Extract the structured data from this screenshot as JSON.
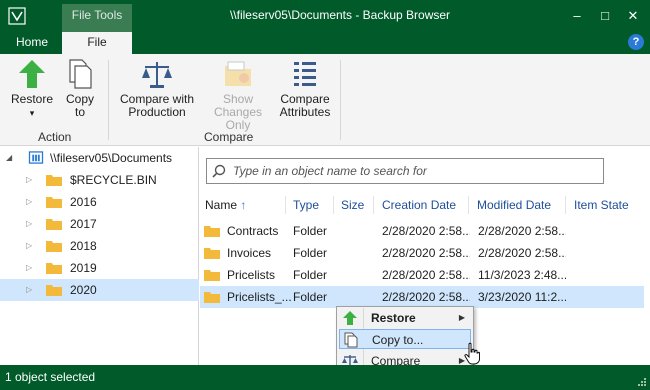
{
  "window": {
    "title": "\\\\fileserv05\\Documents - Backup Browser",
    "context_tab": "File Tools",
    "minimize": "–",
    "maximize": "□",
    "close": "✕"
  },
  "ribbon_tabs": {
    "home": "Home",
    "file": "File",
    "help": "?"
  },
  "ribbon": {
    "restore": "Restore",
    "copy_line1": "Copy",
    "copy_line2": "to",
    "compare_prod_line1": "Compare with",
    "compare_prod_line2": "Production",
    "show_changes_line1": "Show",
    "show_changes_line2": "Changes Only",
    "compare_attr_line1": "Compare",
    "compare_attr_line2": "Attributes",
    "group_action": "Action",
    "group_compare": "Compare",
    "dropdown_arrow": "▾"
  },
  "tree": {
    "root": "\\\\fileserv05\\Documents",
    "items": [
      "$RECYCLE.BIN",
      "2016",
      "2017",
      "2018",
      "2019",
      "2020"
    ],
    "selected": "2020"
  },
  "search": {
    "placeholder": "Type in an object name to search for"
  },
  "columns": {
    "name": "Name",
    "sort_arrow": "↑",
    "type": "Type",
    "size": "Size",
    "creation": "Creation Date",
    "modified": "Modified Date",
    "state": "Item State"
  },
  "files": [
    {
      "name": "Contracts",
      "type": "Folder",
      "size": "",
      "creation": "2/28/2020 2:58...",
      "modified": "2/28/2020 2:58...",
      "state": ""
    },
    {
      "name": "Invoices",
      "type": "Folder",
      "size": "",
      "creation": "2/28/2020 2:58...",
      "modified": "2/28/2020 2:58...",
      "state": ""
    },
    {
      "name": "Pricelists",
      "type": "Folder",
      "size": "",
      "creation": "2/28/2020 2:58...",
      "modified": "11/3/2023 2:48...",
      "state": ""
    },
    {
      "name": "Pricelists_...",
      "type": "Folder",
      "size": "",
      "creation": "2/28/2020 2:58...",
      "modified": "3/23/2020 11:2...",
      "state": ""
    }
  ],
  "context_menu": {
    "restore": "Restore",
    "copy_to": "Copy to...",
    "compare": "Compare",
    "submenu_arrow": "▶"
  },
  "status": {
    "text": "1 object selected"
  },
  "colors": {
    "titlebar": "#005a2a",
    "selection": "#cfe6fc",
    "folder": "#f2b93b",
    "accent_green": "#3cb043",
    "link_blue": "#1f4e99"
  }
}
